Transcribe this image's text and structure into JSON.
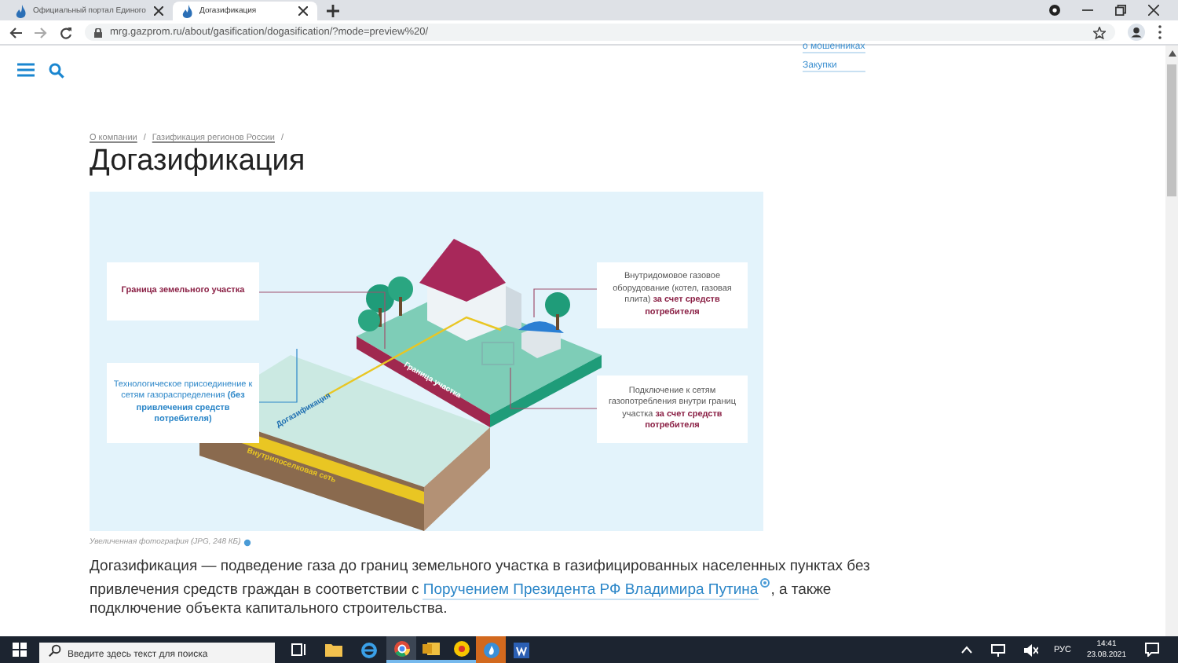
{
  "browser": {
    "tabs": [
      {
        "title": "Официальный портал Единого",
        "selected": false
      },
      {
        "title": "Догазификация",
        "selected": true
      }
    ],
    "address": "mrg.gazprom.ru/about/gasification/dogasification/?mode=preview%20/"
  },
  "header": {
    "links": [
      "о мошенниках",
      "Закупки"
    ]
  },
  "breadcrumbs": {
    "items": [
      "О компании",
      "Газификация регионов России"
    ],
    "separator": "/"
  },
  "title": "Догазификация",
  "figure": {
    "callouts": [
      {
        "kind": "boundary",
        "text": "Граница земельного участка"
      },
      {
        "kind": "consumer",
        "text": "Внутридомовое газовое оборудование (котел, газовая плита) **за счет средств потребителя**"
      },
      {
        "kind": "network",
        "text": "Технологическое присоединение к сетям газораспределения **(без привлечения средств потребителя)**"
      },
      {
        "kind": "consumer",
        "text": "Подключение к сетям газопотребления внутри границ участка **за счет средств потребителя**"
      }
    ],
    "diagram_labels": [
      "Догазификация",
      "Граница участка",
      "Внутрипоселковая сеть"
    ],
    "caption": "Увеличенная фотография (JPG, 248 КБ)"
  },
  "paragraph": {
    "before": "Догазификация — подведение газа до границ земельного участка в газифицированных населенных пунктах без привлечения средств граждан в соответствии с",
    "link": "Поручением Президента РФ Владимира Путина",
    "after": ", а также подключение объекта капитального строительства."
  },
  "taskbar": {
    "search_placeholder": "Введите здесь текст для поиска",
    "language": "РУС",
    "time": "14:41",
    "date": "23.08.2021"
  }
}
